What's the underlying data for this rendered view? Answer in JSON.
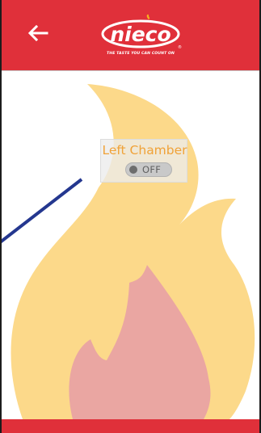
{
  "header": {
    "back_icon": "arrow-left-icon",
    "brand_logo": "nieco-logo",
    "tagline": "THE TASTE YOU CAN COUNT ON"
  },
  "chamber": {
    "label": "Left Chamber",
    "toggle_state": "OFF"
  },
  "colors": {
    "header_bg": "#e0303a",
    "flame_outer": "#fcd98a",
    "flame_inner": "#eaa6a2",
    "label_text": "#f0a238",
    "probe_line": "#24378f"
  }
}
